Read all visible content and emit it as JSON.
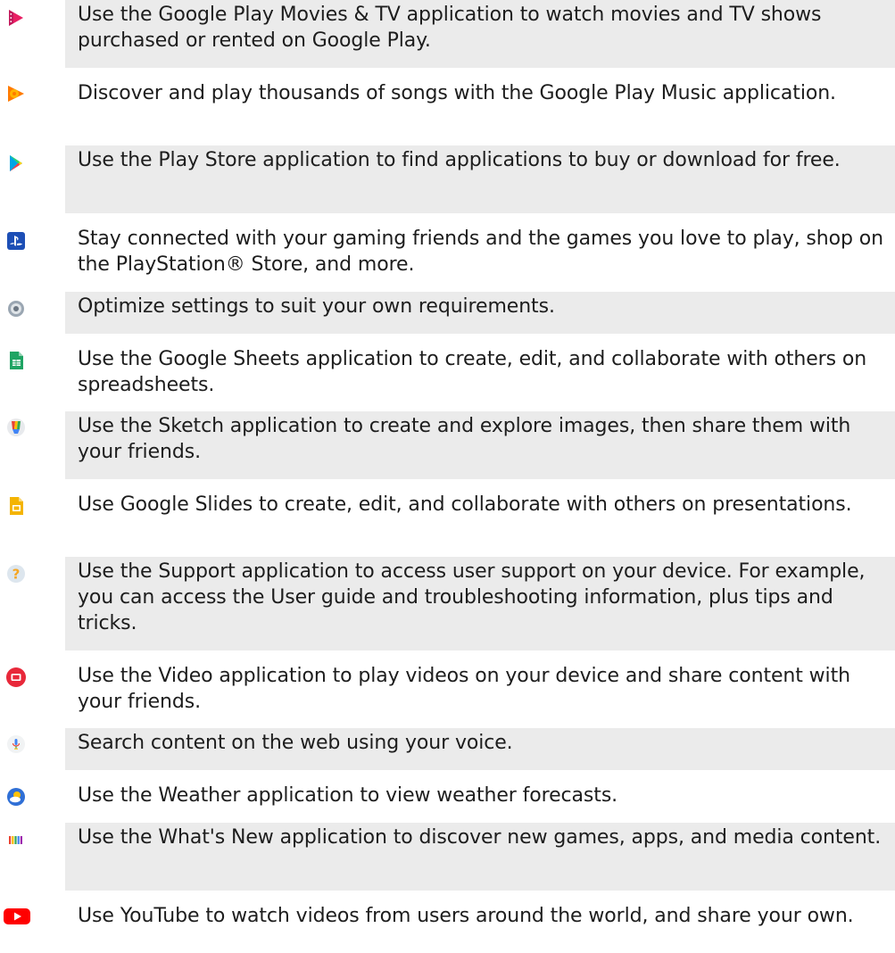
{
  "apps": [
    {
      "icon": "play-movies-icon",
      "description": "Use the Google Play Movies & TV application to watch movies and TV shows purchased or rented on Google Play."
    },
    {
      "icon": "play-music-icon",
      "description": "Discover and play thousands of songs with the Google Play Music application."
    },
    {
      "icon": "play-store-icon",
      "description": "Use the Play Store application to find applications to buy or download for free."
    },
    {
      "icon": "playstation-icon",
      "description": "Stay connected with your gaming friends and the games you love to play, shop on the PlayStation® Store, and more."
    },
    {
      "icon": "settings-icon",
      "description": "Optimize settings to suit your own requirements."
    },
    {
      "icon": "sheets-icon",
      "description": "Use the Google Sheets application to create, edit, and collaborate with others on spreadsheets."
    },
    {
      "icon": "sketch-icon",
      "description": "Use the Sketch application to create and explore images, then share them with your friends."
    },
    {
      "icon": "slides-icon",
      "description": "Use Google Slides to create, edit, and collaborate with others on presentations."
    },
    {
      "icon": "support-icon",
      "description": "Use the Support application to access user support on your device. For example, you can access the User guide and troubleshooting information, plus tips and tricks."
    },
    {
      "icon": "video-icon",
      "description": "Use the Video application to play videos on your device and share content with your friends."
    },
    {
      "icon": "voice-search-icon",
      "description": "Search content on the web using your voice."
    },
    {
      "icon": "weather-icon",
      "description": "Use the Weather application to view weather forecasts."
    },
    {
      "icon": "whats-new-icon",
      "description": "Use the What's New application to discover new games, apps, and media content."
    },
    {
      "icon": "youtube-icon",
      "description": "Use YouTube to watch videos from users around the world, and share your own."
    }
  ]
}
